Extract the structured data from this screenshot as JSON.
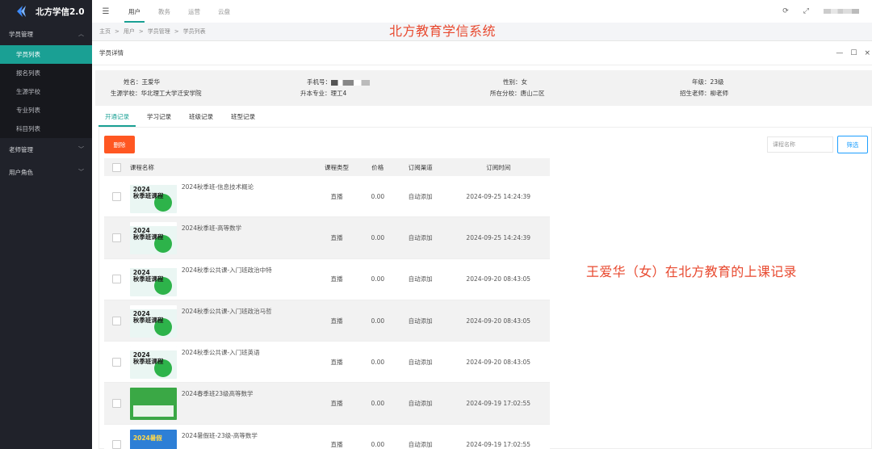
{
  "app": {
    "title": "北方学信2.0"
  },
  "sidebar": {
    "groups": [
      {
        "label": "学员管理",
        "expanded": true,
        "items": [
          {
            "label": "学员列表",
            "active": true
          },
          {
            "label": "报名列表"
          },
          {
            "label": "生源学校"
          },
          {
            "label": "专业列表"
          },
          {
            "label": "科目列表"
          }
        ]
      },
      {
        "label": "老师管理",
        "expanded": false
      },
      {
        "label": "用户角色",
        "expanded": false
      }
    ]
  },
  "header": {
    "tabs": [
      "用户",
      "教务",
      "运营",
      "云盘"
    ],
    "active_tab": "用户"
  },
  "breadcrumb": [
    "主页",
    ">",
    "用户",
    ">",
    "学员管理",
    ">",
    "学员列表"
  ],
  "overlay": {
    "system_title": "北方教育学信系统",
    "note": "王爱华（女）在北方教育的上课记录"
  },
  "modal": {
    "title": "学员详情",
    "controls": [
      "—",
      "☐",
      "×"
    ],
    "info": {
      "name_label": "姓名：",
      "name": "王爱华",
      "phone_label": "手机号：",
      "gender_label": "性别：",
      "gender": "女",
      "grade_label": "年级：",
      "grade": "23级",
      "school_label": "生源学校：",
      "school": "华北理工大学迁安学院",
      "major_label": "升本专业：",
      "major": "理工4",
      "branch_label": "所在分校：",
      "branch": "唐山二区",
      "teacher_label": "招生老师：",
      "teacher": "柳老师"
    },
    "tabs": [
      "开通记录",
      "学习记录",
      "班级记录",
      "班型记录"
    ],
    "active_tab": "开通记录",
    "toolbar": {
      "delete_label": "删除",
      "search_placeholder": "课程名称",
      "filter_label": "筛选"
    },
    "table": {
      "headers": {
        "name": "课程名称",
        "type": "课程类型",
        "price": "价格",
        "channel": "订阅渠道",
        "time": "订阅时间"
      },
      "rows": [
        {
          "name": "2024秋季班-信息技术概论",
          "type": "直播",
          "price": "0.00",
          "channel": "自动添加",
          "time": "2024-09-25 14:24:39",
          "thumb": "2024\n秋季班课程",
          "thumb_style": "autumn"
        },
        {
          "name": "2024秋季班-高等数学",
          "type": "直播",
          "price": "0.00",
          "channel": "自动添加",
          "time": "2024-09-25 14:24:39",
          "thumb": "2024\n秋季班课程",
          "thumb_style": "autumn"
        },
        {
          "name": "2024秋季公共课-入门班政治中特",
          "type": "直播",
          "price": "0.00",
          "channel": "自动添加",
          "time": "2024-09-20 08:43:05",
          "thumb": "2024\n秋季班课程",
          "thumb_style": "autumn"
        },
        {
          "name": "2024秋季公共课-入门班政治马哲",
          "type": "直播",
          "price": "0.00",
          "channel": "自动添加",
          "time": "2024-09-20 08:43:05",
          "thumb": "2024\n秋季班课程",
          "thumb_style": "autumn"
        },
        {
          "name": "2024秋季公共课-入门班英语",
          "type": "直播",
          "price": "0.00",
          "channel": "自动添加",
          "time": "2024-09-20 08:43:05",
          "thumb": "2024\n秋季班课程",
          "thumb_style": "autumn"
        },
        {
          "name": "2024春季班23级高等数学",
          "type": "直播",
          "price": "0.00",
          "channel": "自动添加",
          "time": "2024-09-19 17:02:55",
          "thumb": "",
          "thumb_style": "spring"
        },
        {
          "name": "2024暑假班-23级-高等数学",
          "type": "直播",
          "price": "0.00",
          "channel": "自动添加",
          "time": "2024-09-19 17:02:55",
          "thumb": "2024暑假",
          "thumb_style": "summer"
        }
      ]
    }
  }
}
